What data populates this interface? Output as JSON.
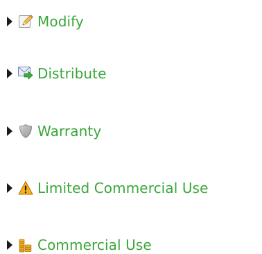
{
  "theme": {
    "label_color": "#3aa63a",
    "toggle_color": "#1a1a1a"
  },
  "items": [
    {
      "label": "Modify",
      "icon": "pencil-icon"
    },
    {
      "label": "Distribute",
      "icon": "envelope-forward-icon"
    },
    {
      "label": "Warranty",
      "icon": "shield-icon"
    },
    {
      "label": "Limited Commercial Use",
      "icon": "warning-icon"
    },
    {
      "label": "Commercial Use",
      "icon": "coins-icon"
    }
  ]
}
